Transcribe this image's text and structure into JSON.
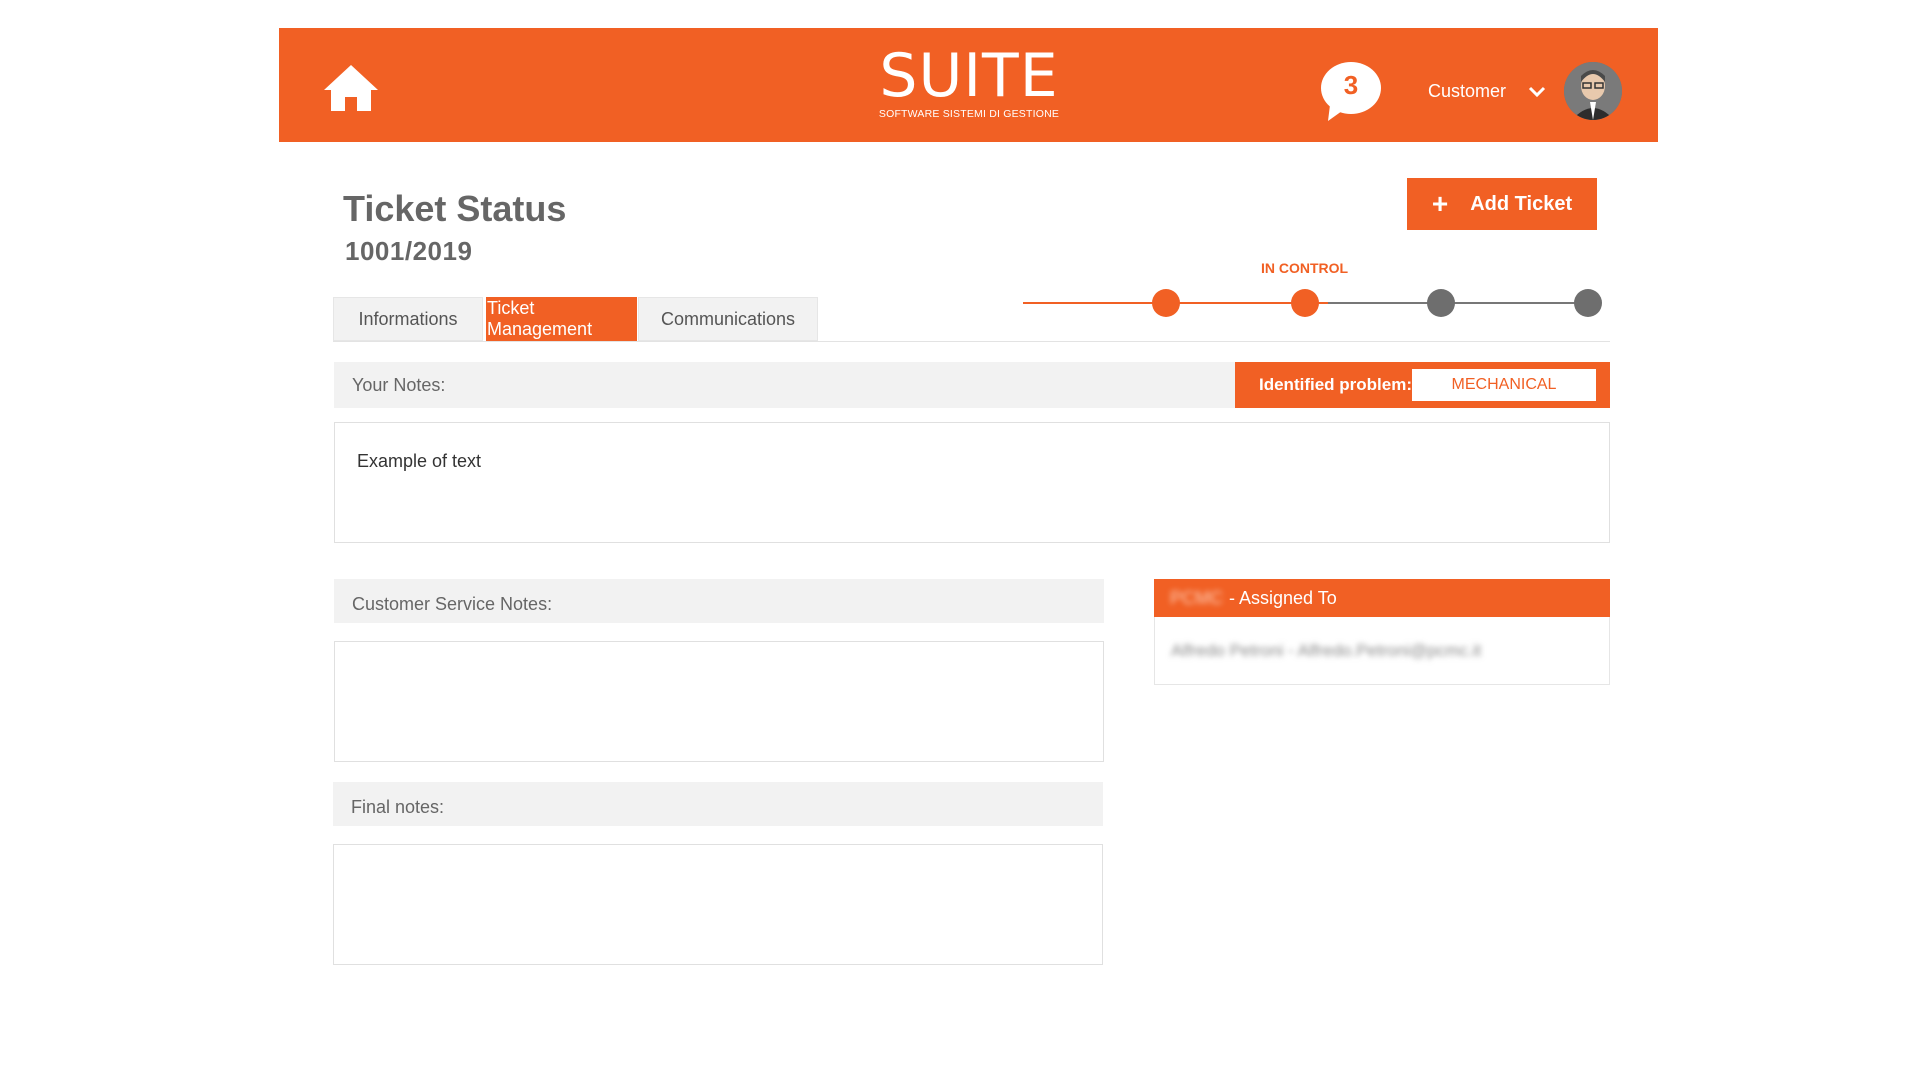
{
  "header": {
    "logo_main": "SUITE",
    "logo_sub": "SOFTWARE SISTEMI DI GESTIONE",
    "notification_count": "3",
    "user_label": "Customer",
    "brand_color": "#f16024"
  },
  "page": {
    "title": "Ticket Status",
    "ticket_id": "1001/2019",
    "add_ticket_label": "Add Ticket"
  },
  "stepper": {
    "current_label": "IN CONTROL",
    "total_steps": 4,
    "completed_steps": 2
  },
  "tabs": [
    {
      "label": "Informations",
      "active": false
    },
    {
      "label": "Ticket Management",
      "active": true
    },
    {
      "label": "Communications",
      "active": false
    }
  ],
  "your_notes": {
    "label": "Your Notes:",
    "text": "Example of text"
  },
  "problem": {
    "label": "Identified problem:",
    "value": "MECHANICAL"
  },
  "customer_service_notes": {
    "label": "Customer Service Notes:",
    "text": ""
  },
  "final_notes": {
    "label": "Final notes:",
    "text": ""
  },
  "assigned": {
    "company": "PCMC",
    "label": "- Assigned To",
    "person": "Alfredo Petroni - Alfredo.Petroni@pcmc.it"
  }
}
